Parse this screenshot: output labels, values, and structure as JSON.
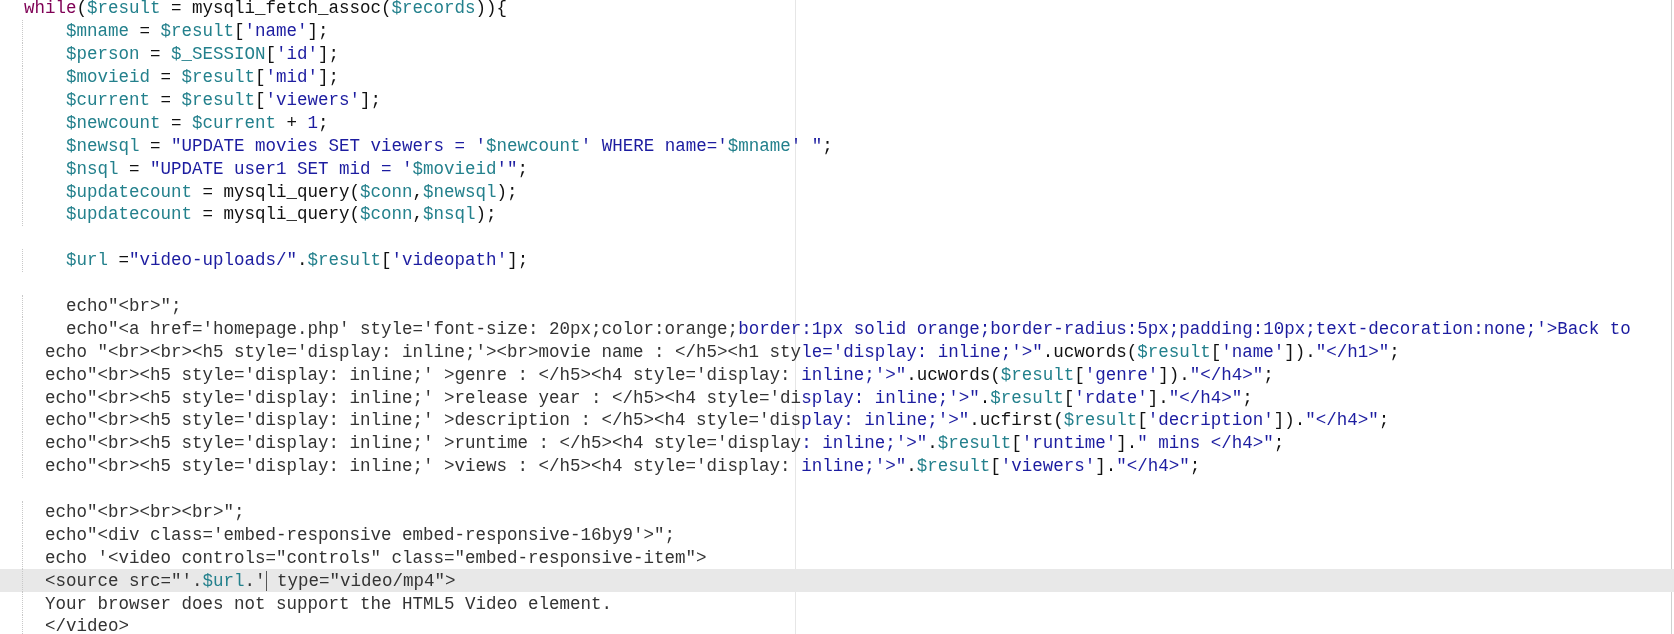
{
  "editor": {
    "lines": [
      {
        "current": false,
        "segments": [
          {
            "kind": "kw",
            "text": "while"
          },
          {
            "kind": "plain",
            "text": "("
          },
          {
            "kind": "var",
            "text": "$result"
          },
          {
            "kind": "plain",
            "text": " = mysqli_fetch_assoc("
          },
          {
            "kind": "var",
            "text": "$records"
          },
          {
            "kind": "plain",
            "text": ")){"
          }
        ]
      },
      {
        "current": false,
        "segments": [
          {
            "kind": "var",
            "text": "    $mname"
          },
          {
            "kind": "plain",
            "text": " = "
          },
          {
            "kind": "var",
            "text": "$result"
          },
          {
            "kind": "plain",
            "text": "["
          },
          {
            "kind": "str",
            "text": "'name'"
          },
          {
            "kind": "plain",
            "text": "];"
          }
        ]
      },
      {
        "current": false,
        "segments": [
          {
            "kind": "var",
            "text": "    $person"
          },
          {
            "kind": "plain",
            "text": " = "
          },
          {
            "kind": "var",
            "text": "$_SESSION"
          },
          {
            "kind": "plain",
            "text": "["
          },
          {
            "kind": "str",
            "text": "'id'"
          },
          {
            "kind": "plain",
            "text": "];"
          }
        ]
      },
      {
        "current": false,
        "segments": [
          {
            "kind": "var",
            "text": "    $movieid"
          },
          {
            "kind": "plain",
            "text": " = "
          },
          {
            "kind": "var",
            "text": "$result"
          },
          {
            "kind": "plain",
            "text": "["
          },
          {
            "kind": "str",
            "text": "'mid'"
          },
          {
            "kind": "plain",
            "text": "];"
          }
        ]
      },
      {
        "current": false,
        "segments": [
          {
            "kind": "var",
            "text": "    $current"
          },
          {
            "kind": "plain",
            "text": " = "
          },
          {
            "kind": "var",
            "text": "$result"
          },
          {
            "kind": "plain",
            "text": "["
          },
          {
            "kind": "str",
            "text": "'viewers'"
          },
          {
            "kind": "plain",
            "text": "];"
          }
        ]
      },
      {
        "current": false,
        "segments": [
          {
            "kind": "var",
            "text": "    $newcount"
          },
          {
            "kind": "plain",
            "text": " = "
          },
          {
            "kind": "var",
            "text": "$current"
          },
          {
            "kind": "plain",
            "text": " + "
          },
          {
            "kind": "num",
            "text": "1"
          },
          {
            "kind": "plain",
            "text": ";"
          }
        ]
      },
      {
        "current": false,
        "segments": [
          {
            "kind": "var",
            "text": "    $newsql"
          },
          {
            "kind": "plain",
            "text": " = "
          },
          {
            "kind": "str",
            "text": "\"UPDATE movies SET viewers = '"
          },
          {
            "kind": "var",
            "text": "$newcount"
          },
          {
            "kind": "str",
            "text": "' WHERE name='"
          },
          {
            "kind": "var",
            "text": "$mname"
          },
          {
            "kind": "str",
            "text": "' \""
          },
          {
            "kind": "plain",
            "text": ";"
          }
        ]
      },
      {
        "current": false,
        "segments": [
          {
            "kind": "var",
            "text": "    $nsql"
          },
          {
            "kind": "plain",
            "text": " = "
          },
          {
            "kind": "str",
            "text": "\"UPDATE user1 SET mid = '"
          },
          {
            "kind": "var",
            "text": "$movieid"
          },
          {
            "kind": "str",
            "text": "'\""
          },
          {
            "kind": "plain",
            "text": ";"
          }
        ]
      },
      {
        "current": false,
        "segments": [
          {
            "kind": "var",
            "text": "    $updatecount"
          },
          {
            "kind": "plain",
            "text": " = mysqli_query("
          },
          {
            "kind": "var",
            "text": "$conn"
          },
          {
            "kind": "plain",
            "text": ","
          },
          {
            "kind": "var",
            "text": "$newsql"
          },
          {
            "kind": "plain",
            "text": ");"
          }
        ]
      },
      {
        "current": false,
        "segments": [
          {
            "kind": "var",
            "text": "    $updatecount"
          },
          {
            "kind": "plain",
            "text": " = mysqli_query("
          },
          {
            "kind": "var",
            "text": "$conn"
          },
          {
            "kind": "plain",
            "text": ","
          },
          {
            "kind": "var",
            "text": "$nsql"
          },
          {
            "kind": "plain",
            "text": ");"
          }
        ]
      },
      {
        "current": false
      },
      {
        "current": false,
        "segments": [
          {
            "kind": "var",
            "text": "    $url"
          },
          {
            "kind": "plain",
            "text": " ="
          },
          {
            "kind": "str",
            "text": "\"video-uploads/\""
          },
          {
            "kind": "plain",
            "text": "."
          },
          {
            "kind": "var",
            "text": "$result"
          },
          {
            "kind": "plain",
            "text": "["
          },
          {
            "kind": "str",
            "text": "'videopath'"
          },
          {
            "kind": "plain",
            "text": "];"
          }
        ]
      },
      {
        "current": false
      },
      {
        "current": false,
        "segments": [
          {
            "kind": "html",
            "text": "    echo\"<br>\";"
          }
        ]
      },
      {
        "current": false,
        "segments": [
          {
            "kind": "html",
            "text": "    echo\"<a href='homepage.php' style='font-size: 20px;color:orange;"
          },
          {
            "kind": "str",
            "text": "border:1px solid orange;border-radius:5px;padding:10px;text-decoration:none;'>Back to"
          }
        ]
      },
      {
        "current": false,
        "segments": [
          {
            "kind": "html",
            "text": "  echo \"<br><br><h5 style='display: inline;'><br>movie name : </h5><h1 sty"
          },
          {
            "kind": "str",
            "text": "le='display: inline;'>\""
          },
          {
            "kind": "plain",
            "text": ".ucwords("
          },
          {
            "kind": "var",
            "text": "$result"
          },
          {
            "kind": "plain",
            "text": "["
          },
          {
            "kind": "str",
            "text": "'name'"
          },
          {
            "kind": "plain",
            "text": "])."
          },
          {
            "kind": "str",
            "text": "\"</h1>\""
          },
          {
            "kind": "plain",
            "text": ";"
          }
        ]
      },
      {
        "current": false,
        "segments": [
          {
            "kind": "html",
            "text": "  echo\"<br><h5 style='display: inline;' >genre : </h5><h4 style='display: "
          },
          {
            "kind": "str",
            "text": "inline;'>\""
          },
          {
            "kind": "plain",
            "text": ".ucwords("
          },
          {
            "kind": "var",
            "text": "$result"
          },
          {
            "kind": "plain",
            "text": "["
          },
          {
            "kind": "str",
            "text": "'genre'"
          },
          {
            "kind": "plain",
            "text": "])."
          },
          {
            "kind": "str",
            "text": "\"</h4>\""
          },
          {
            "kind": "plain",
            "text": ";"
          }
        ]
      },
      {
        "current": false,
        "segments": [
          {
            "kind": "html",
            "text": "  echo\"<br><h5 style='display: inline;' >release year : </h5><h4 style='di"
          },
          {
            "kind": "str",
            "text": "splay: inline;'>\""
          },
          {
            "kind": "plain",
            "text": "."
          },
          {
            "kind": "var",
            "text": "$result"
          },
          {
            "kind": "plain",
            "text": "["
          },
          {
            "kind": "str",
            "text": "'rdate'"
          },
          {
            "kind": "plain",
            "text": "]."
          },
          {
            "kind": "str",
            "text": "\"</h4>\""
          },
          {
            "kind": "plain",
            "text": ";"
          }
        ]
      },
      {
        "current": false,
        "segments": [
          {
            "kind": "html",
            "text": "  echo\"<br><h5 style='display: inline;' >description : </h5><h4 style='dis"
          },
          {
            "kind": "str",
            "text": "play: inline;'>\""
          },
          {
            "kind": "plain",
            "text": ".ucfirst("
          },
          {
            "kind": "var",
            "text": "$result"
          },
          {
            "kind": "plain",
            "text": "["
          },
          {
            "kind": "str",
            "text": "'decription'"
          },
          {
            "kind": "plain",
            "text": "])."
          },
          {
            "kind": "str",
            "text": "\"</h4>\""
          },
          {
            "kind": "plain",
            "text": ";"
          }
        ]
      },
      {
        "current": false,
        "segments": [
          {
            "kind": "html",
            "text": "  echo\"<br><h5 style='display: inline;' >runtime : </h5><h4 style='display"
          },
          {
            "kind": "str",
            "text": ": inline;'>\""
          },
          {
            "kind": "plain",
            "text": "."
          },
          {
            "kind": "var",
            "text": "$result"
          },
          {
            "kind": "plain",
            "text": "["
          },
          {
            "kind": "str",
            "text": "'runtime'"
          },
          {
            "kind": "plain",
            "text": "]."
          },
          {
            "kind": "str",
            "text": "\" mins </h4>\""
          },
          {
            "kind": "plain",
            "text": ";"
          }
        ]
      },
      {
        "current": false,
        "segments": [
          {
            "kind": "html",
            "text": "  echo\"<br><h5 style='display: inline;' >views : </h5><h4 style='display: "
          },
          {
            "kind": "str",
            "text": "inline;'>\""
          },
          {
            "kind": "plain",
            "text": "."
          },
          {
            "kind": "var",
            "text": "$result"
          },
          {
            "kind": "plain",
            "text": "["
          },
          {
            "kind": "str",
            "text": "'viewers'"
          },
          {
            "kind": "plain",
            "text": "]."
          },
          {
            "kind": "str",
            "text": "\"</h4>\""
          },
          {
            "kind": "plain",
            "text": ";"
          }
        ]
      },
      {
        "current": false
      },
      {
        "current": false,
        "segments": [
          {
            "kind": "html",
            "text": "  echo\"<br><br><br>\";"
          }
        ]
      },
      {
        "current": false,
        "segments": [
          {
            "kind": "html",
            "text": "  echo\"<div class='embed-responsive embed-responsive-16by9'>\";"
          }
        ]
      },
      {
        "current": false,
        "segments": [
          {
            "kind": "html",
            "text": "  echo '<video controls=\"controls\" class=\"embed-responsive-item\">"
          }
        ]
      },
      {
        "current": true,
        "segments": [
          {
            "kind": "html",
            "text": "  <source src=\"'."
          },
          {
            "kind": "var",
            "text": "$url"
          },
          {
            "kind": "html",
            "text": ".'"
          },
          {
            "kind": "cursor"
          },
          {
            "kind": "html",
            "text": " type=\"video/mp4\">"
          }
        ]
      },
      {
        "current": false,
        "segments": [
          {
            "kind": "html",
            "text": "  Your browser does not support the HTML5 Video element."
          }
        ]
      },
      {
        "current": false,
        "segments": [
          {
            "kind": "html",
            "text": "  </video>"
          }
        ]
      }
    ]
  }
}
